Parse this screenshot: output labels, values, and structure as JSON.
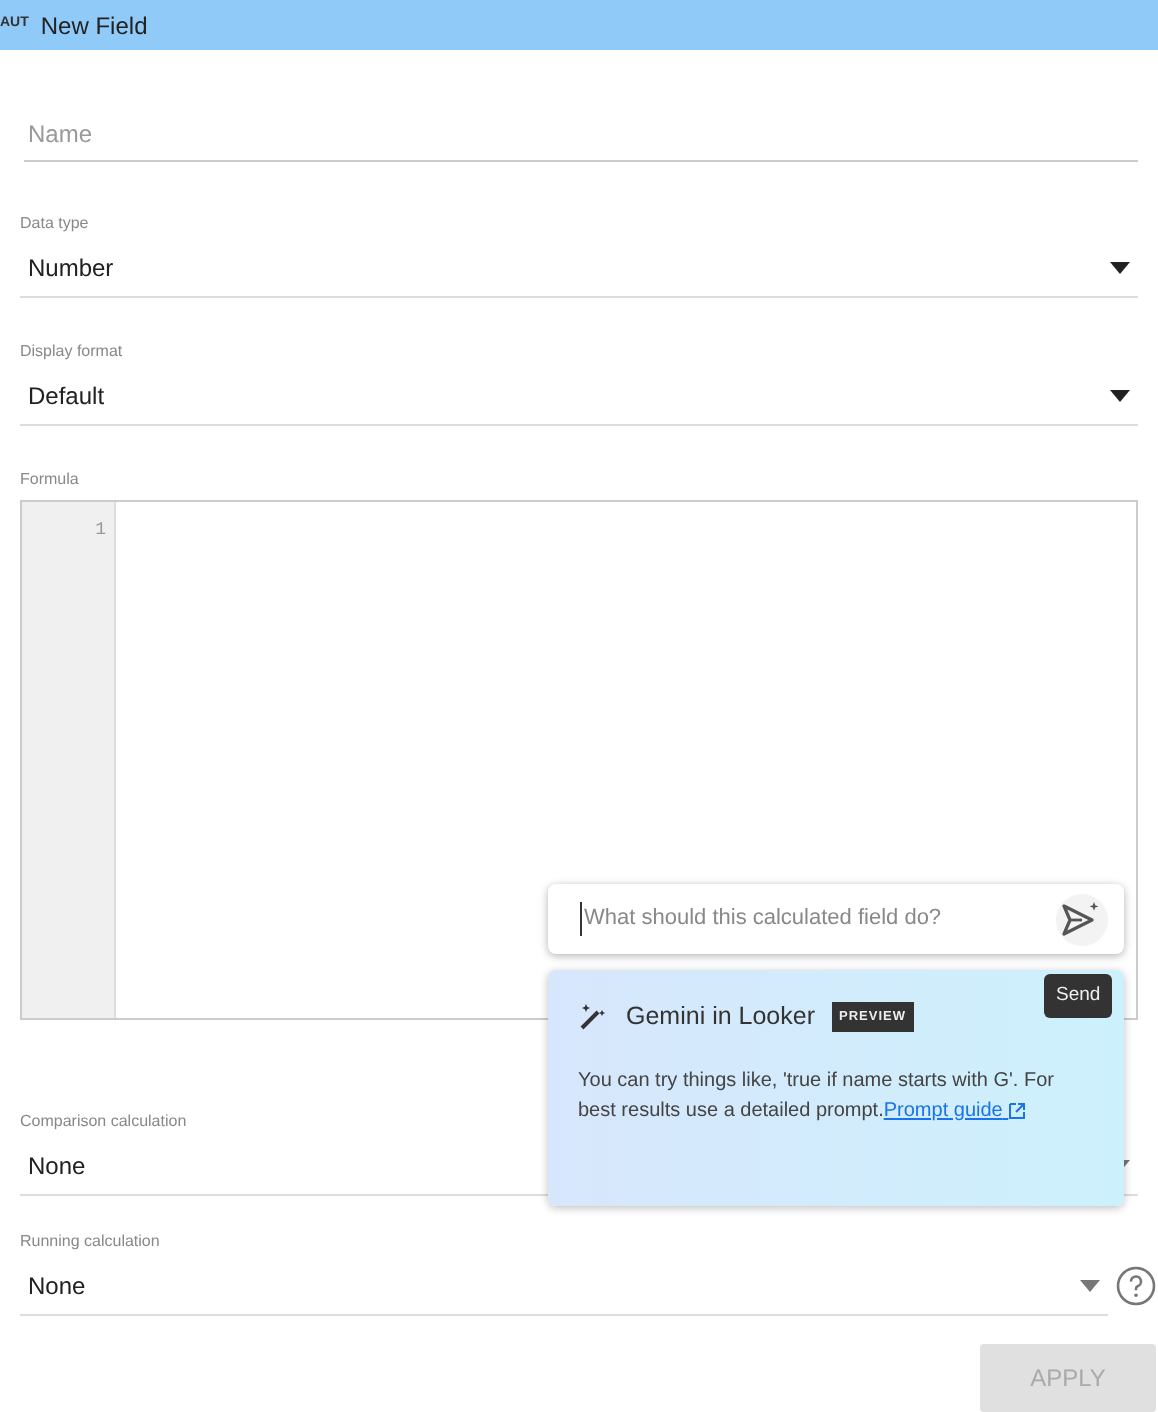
{
  "header": {
    "badge": "AUT",
    "title": "New Field"
  },
  "name_field": {
    "placeholder": "Name"
  },
  "selects": [
    {
      "label": "Data type",
      "value": "Number"
    },
    {
      "label": "Display format",
      "value": "Default"
    }
  ],
  "formula": {
    "label": "Formula",
    "line_numbers": [
      "1"
    ]
  },
  "calc_selects": [
    {
      "label": "Comparison calculation",
      "value": "None",
      "help": false
    },
    {
      "label": "Running calculation",
      "value": "None",
      "help": true
    }
  ],
  "apply_button": {
    "label": "APPLY",
    "disabled": true
  },
  "prompt": {
    "placeholder": "What should this calculated field do?",
    "tooltip": "Send"
  },
  "gemini": {
    "title": "Gemini in Looker",
    "badge": "PREVIEW",
    "text": "You can try things like, 'true if name starts with G'. For best results use a detailed prompt.",
    "link": "Prompt guide"
  }
}
